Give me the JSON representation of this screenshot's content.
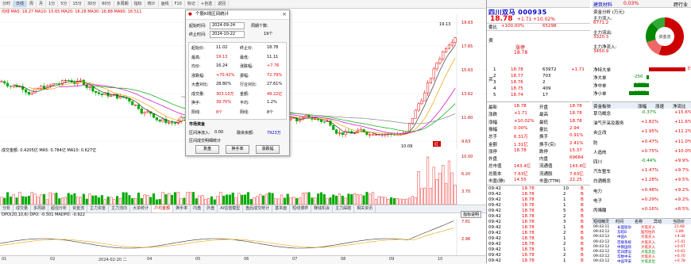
{
  "toolbar": {
    "items": [
      "分时",
      "日线",
      "周",
      "月",
      "1分",
      "5分",
      "15分",
      "30分",
      "60分",
      "多周期",
      "指标",
      "统计",
      "画线",
      "F10",
      "标记",
      "+自选",
      "返回"
    ],
    "active_index": 1,
    "stock_toolbar": [
      "买",
      "卖",
      "+",
      "九转",
      "预警",
      "",
      "",
      "",
      "叠加",
      "统计",
      "画线",
      "",
      "F10",
      "标记",
      "+自选",
      "",
      "返回"
    ]
  },
  "main_chart": {
    "ma_line": "均线 MA5: 18.27  MA10: 15.65  MA20: 16.28  MA30: 16.88  MA60: 16.511",
    "price_labels": [
      "19.13",
      "15.13",
      "10.37",
      "7.78",
      "2.76",
      "5.64"
    ],
    "right_axis": [
      "19.63",
      "17.65",
      "15.63",
      "13.62",
      "11.60",
      "9.63"
    ],
    "high_label": "19.13",
    "low_label": "10.09",
    "red_tag": "红",
    "volume_line": "成交金额: 0.4205亿  MA5: 0.784亿  MA10: 0.627亿",
    "volume_axis": [
      "10.00",
      "6.20",
      "3.70"
    ],
    "sub_tabs": [
      "分析",
      "成交量",
      "多周期",
      "超强分析",
      "资金流",
      "主力资金",
      "主力流向",
      "大单统计",
      "户均金额",
      "换手率",
      "内盘",
      "外盘",
      "AI估值模型",
      "盘后成交统计",
      "基本面",
      "短线博弈",
      "赚钱机会",
      "主力踩踏",
      "相关资讯"
    ],
    "sub_tab_active": 8,
    "dpo_line": "DPO(20,10,6) DPO: -0.501  MADPO: -0.922",
    "dpo_axis": [
      "7.81",
      "2.96"
    ],
    "dpo_badge": "指标说明",
    "date_axis": [
      "01",
      "02",
      "2024-02-20 二",
      "04",
      "05",
      "06",
      "07",
      "08",
      "09",
      "10"
    ]
  },
  "dialog": {
    "title": "个股K线区间统计",
    "start_label": "起始时间:",
    "start_value": "2024-09-24",
    "end_label": "终止时间:",
    "end_value": "2024-10-22",
    "period_label": "周期个数:",
    "period_value": "19个",
    "stats": [
      {
        "k": "起始价:",
        "v": "11.02",
        "k2": "终止价:",
        "v2": "18.78"
      },
      {
        "k": "最高:",
        "v": "19.13",
        "k2": "最低:",
        "v2": "11.11"
      },
      {
        "k": "均价:",
        "v": "16.24",
        "k2": "涨跌幅:",
        "v2": "+7.76"
      },
      {
        "k": "涨跌幅:",
        "v": "+70.42%",
        "k2": "振幅:",
        "v2": "72.79%"
      },
      {
        "k": "大盘对比:",
        "v": "28.80%",
        "k2": "行业对比:",
        "v2": "27.61%"
      },
      {
        "k": "成交量:",
        "v": "303.10万",
        "k2": "金额:",
        "v2": "49.22亿"
      },
      {
        "k": "换手:",
        "v": "39.70%",
        "k2": "平均:",
        "v2": "1.2%"
      },
      {
        "k": "阳线:",
        "v": "8个",
        "k2": "阴线:",
        "v2": "8个"
      }
    ],
    "funds_head": "市场资金",
    "funds_text": "区间净流入:",
    "funds_v1": "0.00",
    "funds_k2": "融资余额:",
    "funds_v2": "7923万",
    "detail_head": "区间成交明细统计",
    "buttons": [
      "复盘",
      "换手率",
      "涨跌幅"
    ]
  },
  "panel": {
    "stock_name": "四川双马",
    "stock_code": "000935",
    "price": "18.78",
    "change": "+1.71",
    "pct": "+10.02%",
    "weibi_label": "委比",
    "weibi": "+100.00%",
    "weicha": "65298",
    "order_label_buy": "买",
    "order_label_sell": "卖",
    "sell_label": "涨停",
    "sell_price": "18.78",
    "buy_rows": [
      {
        "n": "1",
        "p": "18.78",
        "v": "63972",
        "d": "+1.71"
      },
      {
        "n": "2",
        "p": "18.77",
        "v": "703"
      },
      {
        "n": "3",
        "p": "18.76",
        "v": "2"
      },
      {
        "n": "4",
        "p": "18.75",
        "v": "409"
      },
      {
        "n": "5",
        "p": "18.74",
        "v": "17"
      }
    ],
    "quote": [
      {
        "k": "最新",
        "v": "18.78",
        "k2": "开盘",
        "v2": "18.78"
      },
      {
        "k": "涨跌",
        "v": "+1.71",
        "k2": "最高",
        "v2": "18.78"
      },
      {
        "k": "涨幅",
        "v": "+10.02%",
        "k2": "最低",
        "v2": "18.78"
      },
      {
        "k": "振幅",
        "v": "0.00%",
        "k2": "量比",
        "v2": "2.94"
      },
      {
        "k": "总手",
        "v": "6.31万",
        "k2": "换手",
        "v2": "0.91%"
      },
      {
        "k": "金额",
        "v": "1.31亿",
        "k2": "换手(实)",
        "v2": "2.41%"
      },
      {
        "k": "涨停",
        "v": "18.78",
        "k2": "跌停",
        "v2": "15.37"
      },
      {
        "k": "外盘",
        "v": "",
        "k2": "内盘",
        "v2": "69684"
      },
      {
        "k": "总市值",
        "v": "143.4亿",
        "k2": "流通值",
        "v2": "143.4亿"
      },
      {
        "k": "总股本",
        "v": "7.63亿",
        "k2": "流通股",
        "v2": "7.63亿"
      },
      {
        "k": "市盈(静)",
        "v": "14.55",
        "k2": "市盈(TTM)",
        "v2": "22.25"
      }
    ],
    "trades": [
      {
        "t": "09:42",
        "p": "18.78",
        "v": "10",
        "d": "B"
      },
      {
        "t": "09:42",
        "p": "18.78",
        "v": "2",
        "d": "B"
      },
      {
        "t": "09:42",
        "p": "18.78",
        "v": "1",
        "d": "B"
      },
      {
        "t": "09:42",
        "p": "18.78",
        "v": "1",
        "d": "B"
      },
      {
        "t": "09:42",
        "p": "18.78",
        "v": "5",
        "d": "B"
      },
      {
        "t": "09:42",
        "p": "18.78",
        "v": "2",
        "d": "B"
      },
      {
        "t": "09:42",
        "p": "18.78",
        "v": "3",
        "d": "B"
      },
      {
        "t": "09:42",
        "p": "18.78",
        "v": "1",
        "d": "B"
      },
      {
        "t": "09:42",
        "p": "18.78",
        "v": "2",
        "d": "B"
      },
      {
        "t": "09:42",
        "p": "18.78",
        "v": "1",
        "d": "B"
      },
      {
        "t": "09:42",
        "p": "18.78",
        "v": "2",
        "d": "B"
      },
      {
        "t": "09:42",
        "p": "18.78",
        "v": "1",
        "d": "B"
      },
      {
        "t": "09:42",
        "p": "18.78",
        "v": "2",
        "d": "B"
      },
      {
        "t": "09:42",
        "p": "18.78",
        "v": "1",
        "d": "B"
      }
    ],
    "sector_title": "建筑材料",
    "sector_pct": "0.03%",
    "sector_more": "跨行业",
    "funds_title": "资金分析 (万元)",
    "funds_rows": [
      {
        "k": "主力流入:",
        "v": "6771.2"
      },
      {
        "k": "主力流出:",
        "v": "3320.3"
      },
      {
        "k": "主力净流入:",
        "v": "3450.9"
      }
    ],
    "pie_label": "资金流",
    "net_rows": [
      {
        "k": "净特大单",
        "v": "3701",
        "c": "red"
      },
      {
        "k": "净大单",
        "v": "-250",
        "c": "green"
      },
      {
        "k": "净中单",
        "v": "-1488",
        "c": "green"
      },
      {
        "k": "净小单",
        "v": "-1963",
        "c": "green"
      }
    ],
    "concept_head": "资金板块",
    "concept_cols": [
      "涨幅",
      "涨速",
      "净流比"
    ],
    "concepts": [
      {
        "n": "草乌概念",
        "a": "-0.37%",
        "b": "+15.6%"
      },
      {
        "n": "油气开采及服务",
        "a": "+1.82%",
        "b": "+11.6%"
      },
      {
        "n": "央企改",
        "a": "+1.95%",
        "b": "+11.2%"
      },
      {
        "n": "防",
        "a": "+0.47%",
        "b": "+11.0%"
      },
      {
        "n": "人造肉",
        "a": "+0.75%",
        "b": "+10.0%"
      },
      {
        "n": "四川",
        "a": "-0.44%",
        "b": "+9.9%"
      },
      {
        "n": "汽车整车",
        "a": "+1.47%",
        "b": "+9.7%"
      },
      {
        "n": "白酒概念",
        "a": "+1.28%",
        "b": "+9.5%"
      },
      {
        "n": "电力",
        "a": "+0.48%",
        "b": "+9.2%"
      },
      {
        "n": "电子",
        "a": "+0.29%",
        "b": "+9.2%"
      },
      {
        "n": "丙烯酸",
        "a": "+0.16%",
        "b": "+8.5%"
      }
    ],
    "news_head": "短线精灵",
    "news_cols": [
      "时间",
      "名称",
      "异动",
      "当前价"
    ],
    "news": [
      {
        "t": "09:43:11",
        "n": "长盛股份",
        "e": "大笔买入",
        "v": "21.68"
      },
      {
        "t": "09:43:12",
        "n": "东睦B",
        "e": "猛烈拉升",
        "v": "-1.89"
      },
      {
        "t": "09:43:12",
        "n": "中国A",
        "e": "大笔买入",
        "v": "+4.34"
      },
      {
        "t": "09:43:12",
        "n": "百联系统",
        "e": "大笔买入",
        "v": "+5.41"
      },
      {
        "t": "09:43:12",
        "n": "中钢国际",
        "e": "大笔买入",
        "v": "+0.67"
      },
      {
        "t": "09:43:12",
        "n": "宏润建设",
        "e": "大笔卖出",
        "v": "+0.61"
      },
      {
        "t": "09:43:12",
        "n": "华数中天",
        "e": "大笔买入",
        "v": "+0.70"
      },
      {
        "t": "09:43:12",
        "n": "中国平安",
        "e": "大笔卖出",
        "v": "+0.78"
      }
    ]
  }
}
